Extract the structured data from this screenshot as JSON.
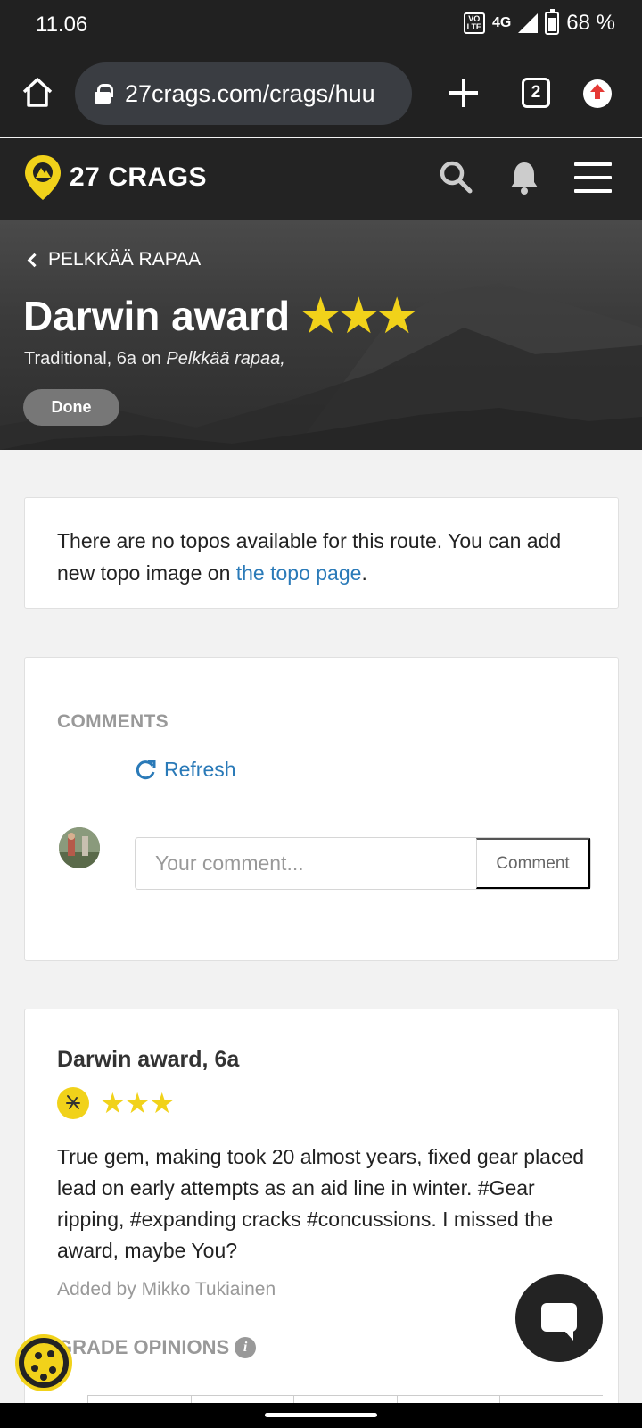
{
  "status_bar": {
    "time": "11.06",
    "volte": "VO\nLTE",
    "network": "4G",
    "battery": "68 %"
  },
  "browser": {
    "url": "27crags.com/crags/huu",
    "tab_count": "2"
  },
  "site": {
    "logo_text": "27 CRAGS",
    "brand_color": "#f1d21a"
  },
  "hero": {
    "back_label": "PELKKÄÄ RAPAA",
    "route_name": "Darwin award",
    "stars": "★★★",
    "sub_prefix": "Traditional, 6a on ",
    "sub_crag": "Pelkkää rapaa,",
    "done_label": "Done"
  },
  "topo": {
    "text_before": "There are no topos available for this route. You can add new topo image on ",
    "link_text": "the topo page",
    "text_after": "."
  },
  "comments": {
    "title": "COMMENTS",
    "refresh_label": "Refresh",
    "placeholder": "Your comment...",
    "submit_label": "Comment"
  },
  "route_card": {
    "title": "Darwin award, 6a",
    "stars": "★★★",
    "description": "True gem, making took 20 almost years, fixed gear placed lead on early attempts as an aid line in winter. #Gear ripping, #expanding cracks #concussions. I missed the award, maybe You?",
    "added_by": "Added by Mikko Tukiainen",
    "grade_opinions_title": "GRADE OPINIONS",
    "info_icon_glyph": "i"
  }
}
